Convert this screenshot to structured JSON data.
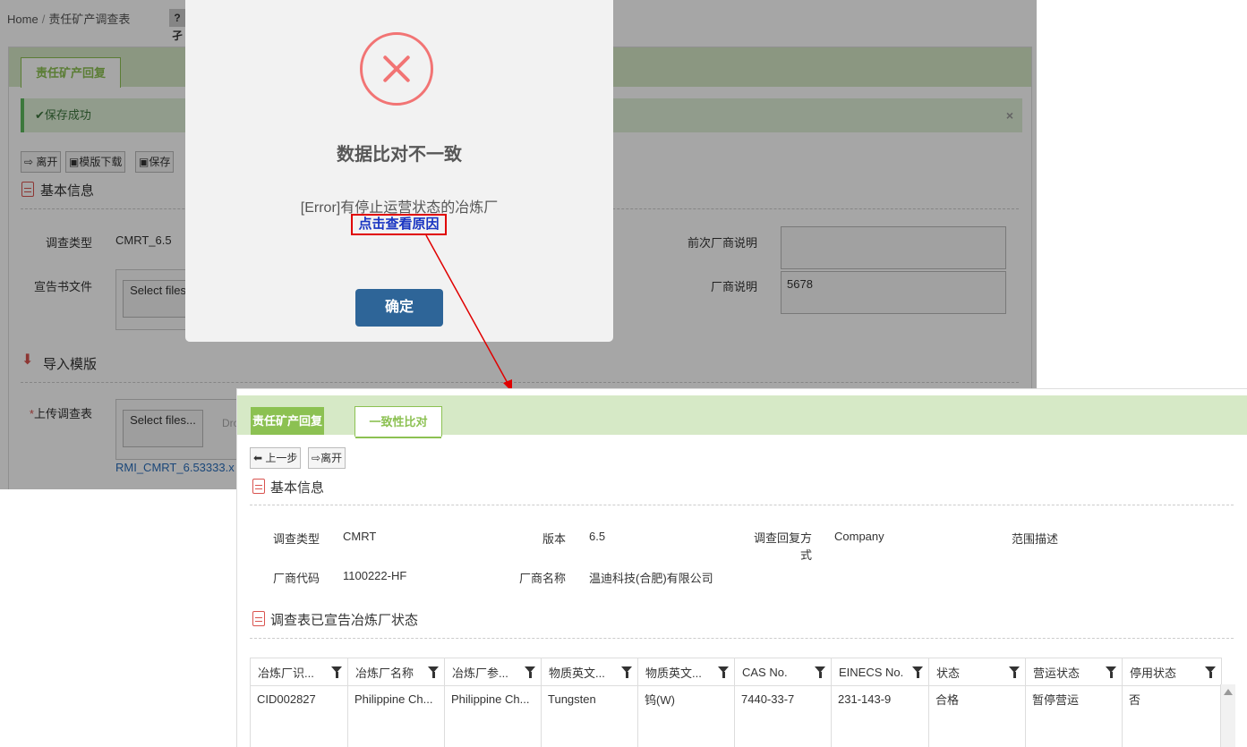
{
  "background_page": {
    "breadcrumb": {
      "home": "Home",
      "separator": "/",
      "current": "责任矿产调查表"
    },
    "help_button": "?孑",
    "tab": "责任矿产回复",
    "alert": {
      "text": "保存成功",
      "close": "×"
    },
    "toolbar": {
      "leave": "离开",
      "template_download": "模版下载",
      "save": "保存"
    },
    "section_basic": "基本信息",
    "survey_type_label": "调查类型",
    "survey_type_value": "CMRT_6.5",
    "declaration_label": "宣告书文件",
    "select_files": "Select files...",
    "prev_vendor_note_label": "前次厂商说明",
    "vendor_note_label": "厂商说明",
    "vendor_note_value": "5678",
    "section_import": "导入模版",
    "upload_label": "上传调查表",
    "upload_hint": "Drop files here to upload",
    "uploaded_file": "RMI_CMRT_6.53333.x"
  },
  "dialog": {
    "title": "数据比对不一致",
    "message": "[Error]有停止运营状态的冶炼厂",
    "link": "点击查看原因",
    "ok": "确定"
  },
  "inset": {
    "tabs": [
      "责任矿产回复",
      "一致性比对"
    ],
    "toolbar": {
      "prev": "上一步",
      "leave": "离开"
    },
    "section_basic": "基本信息",
    "fields": {
      "survey_type_label": "调查类型",
      "survey_type_value": "CMRT",
      "version_label": "版本",
      "version_value": "6.5",
      "reply_mode_label": "调查回复方式",
      "reply_mode_value": "Company",
      "scope_label": "范围描述",
      "vendor_code_label": "厂商代码",
      "vendor_code_value": "1100222-HF",
      "vendor_name_label": "厂商名称",
      "vendor_name_value": "温迪科技(合肥)有限公司"
    },
    "section_smelters": "调查表已宣告冶炼厂状态",
    "columns": [
      "冶炼厂识...",
      "冶炼厂名称",
      "冶炼厂参...",
      "物质英文...",
      "物质英文...",
      "CAS No.",
      "EINECS No.",
      "状态",
      "营运状态",
      "停用状态"
    ],
    "rows": [
      [
        "CID002827",
        "Philippine Ch...",
        "Philippine Ch...",
        "Tungsten",
        "钨(W)",
        "7440-33-7",
        "231-143-9",
        "合格",
        "暂停营运",
        "否"
      ]
    ]
  }
}
